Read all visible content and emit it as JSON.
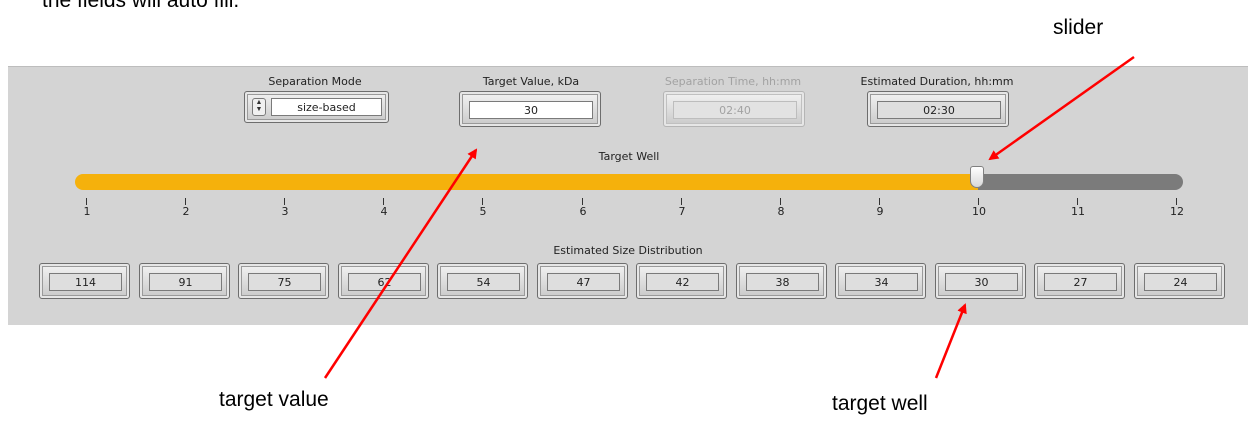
{
  "document": {
    "top_text": "the fields will auto fill.",
    "callouts": {
      "slider": "slider",
      "target_value": "target value",
      "target_well": "target well"
    },
    "arrow_color": "#ff0000"
  },
  "panel": {
    "separation_mode": {
      "label": "Separation Mode",
      "value": "size-based"
    },
    "target_value": {
      "label": "Target Value, kDa",
      "value": "30"
    },
    "separation_time": {
      "label": "Separation Time, hh:mm",
      "value": "02:40",
      "disabled": true
    },
    "estimated_duration": {
      "label": "Estimated Duration, hh:mm",
      "value": "02:30"
    },
    "target_well": {
      "label": "Target Well",
      "ticks": [
        "1",
        "2",
        "3",
        "4",
        "5",
        "6",
        "7",
        "8",
        "9",
        "10",
        "11",
        "12"
      ],
      "selected": 10,
      "colors": {
        "fill": "#f5b10c",
        "rest": "#7b7b7b"
      }
    },
    "size_distribution": {
      "label": "Estimated Size Distribution",
      "values": [
        "114",
        "91",
        "75",
        "62",
        "54",
        "47",
        "42",
        "38",
        "34",
        "30",
        "27",
        "24"
      ]
    }
  }
}
